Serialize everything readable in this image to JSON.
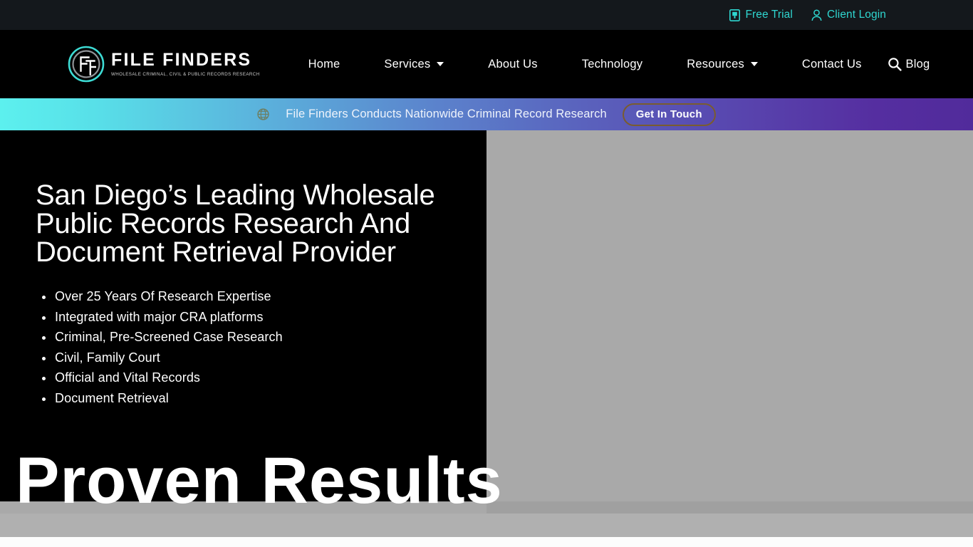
{
  "topbar": {
    "links": [
      {
        "label": "Free Trial",
        "icon": "document-trial-icon"
      },
      {
        "label": "Client Login",
        "icon": "user-icon"
      }
    ],
    "link_color": "#2fd6d0",
    "background": "#14181c"
  },
  "header": {
    "background": "#000000",
    "logo": {
      "monogram": "FF",
      "name": "FILE FINDERS",
      "tagline": "WHOLESALE CRIMINAL, CIVIL & PUBLIC RECORDS RESEARCH",
      "accent": "#3ddbd4"
    },
    "nav": [
      {
        "label": "Home",
        "has_dropdown": false
      },
      {
        "label": "Services",
        "has_dropdown": true
      },
      {
        "label": "About Us",
        "has_dropdown": false
      },
      {
        "label": "Technology",
        "has_dropdown": false
      },
      {
        "label": "Resources",
        "has_dropdown": true
      },
      {
        "label": "Contact Us",
        "has_dropdown": false
      },
      {
        "label": "Blog",
        "has_dropdown": false
      }
    ],
    "search_icon": "search-icon"
  },
  "announcement": {
    "icon": "globe-icon",
    "text": "File Finders Conducts Nationwide Criminal Record Research",
    "button_label": "Get In Touch",
    "gradient_start": "#5cf0ee",
    "gradient_mid": "#5b82cc",
    "gradient_end": "#512b9b",
    "button_border": "#7a5c2e"
  },
  "hero": {
    "title": "San Diego’s Leading Wholesale Public Records Research And Document Retrieval Provider",
    "bullets": [
      "Over 25 Years Of Research Expertise",
      "Integrated with major CRA platforms",
      "Criminal, Pre-Screened Case Research",
      "Civil, Family Court",
      "Official and Vital Records",
      "Document Retrieval"
    ],
    "panel_background": "#000000",
    "right_background": "#a9a9a9"
  },
  "section": {
    "heading": "Proven Results"
  }
}
